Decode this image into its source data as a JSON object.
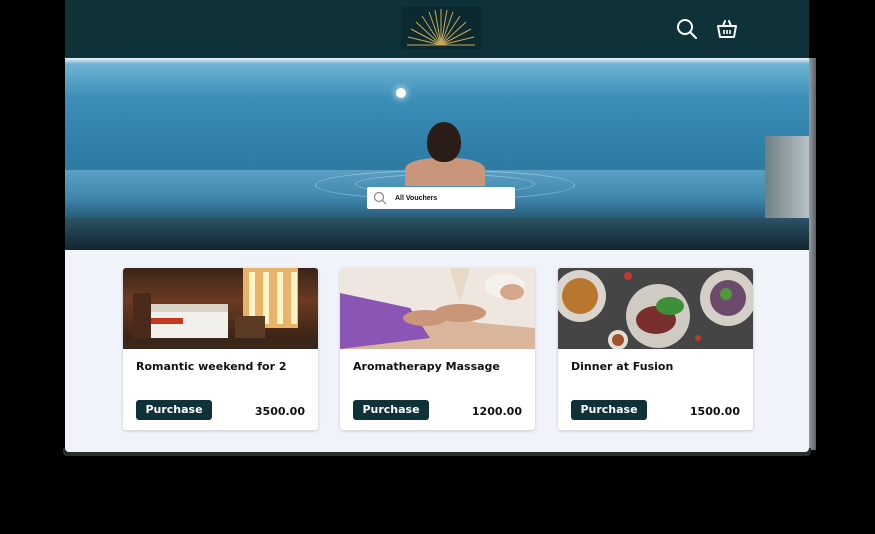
{
  "header": {
    "logo": "sunburst-logo",
    "search_icon": "search-icon",
    "cart_icon": "basket-icon",
    "bg_color": "#0e3238"
  },
  "hero": {
    "search_text": "All Vouchers"
  },
  "vouchers": [
    {
      "title": "Romantic weekend for 2",
      "button": "Purchase",
      "price": "3500.00"
    },
    {
      "title": "Aromatherapy Massage",
      "button": "Purchase",
      "price": "1200.00"
    },
    {
      "title": "Dinner at Fusion",
      "button": "Purchase",
      "price": "1500.00"
    }
  ],
  "colors": {
    "accent": "#0e3238",
    "page_bg": "#f1f3fa",
    "logo_gold": "#c8a95a"
  }
}
